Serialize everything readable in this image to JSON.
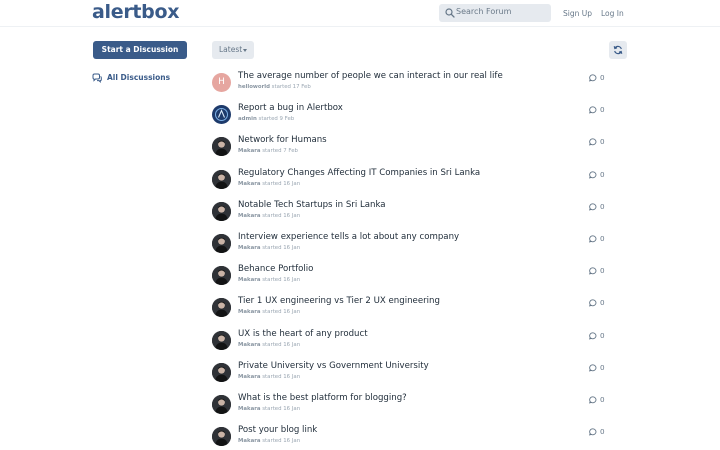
{
  "header": {
    "logo": "alertbox",
    "search_placeholder": "Search Forum",
    "signup_label": "Sign Up",
    "login_label": "Log In"
  },
  "sidebar": {
    "start_label": "Start a Discussion",
    "all_label": "All Discussions"
  },
  "toolbar": {
    "sort_label": "Latest"
  },
  "colors": {
    "brand": "#3a5b89",
    "avatar_letter_bg": "#e6a6a0"
  },
  "discussions": [
    {
      "title": "The average number of people we can interact in our real life",
      "user": "helloworld",
      "started": "started 17 Feb",
      "replies": "0",
      "avatar": "letter",
      "initial": "H"
    },
    {
      "title": "Report a bug in Alertbox",
      "user": "admin",
      "started": "started 9 Feb",
      "replies": "0",
      "avatar": "admin",
      "initial": ""
    },
    {
      "title": "Network for Humans",
      "user": "Makara",
      "started": "started 7 Feb",
      "replies": "0",
      "avatar": "photo",
      "initial": ""
    },
    {
      "title": "Regulatory Changes Affecting IT Companies in Sri Lanka",
      "user": "Makara",
      "started": "started 16 Jan",
      "replies": "0",
      "avatar": "photo",
      "initial": ""
    },
    {
      "title": "Notable Tech Startups in Sri Lanka",
      "user": "Makara",
      "started": "started 16 Jan",
      "replies": "0",
      "avatar": "photo",
      "initial": ""
    },
    {
      "title": "Interview experience tells a lot about any company",
      "user": "Makara",
      "started": "started 16 Jan",
      "replies": "0",
      "avatar": "photo",
      "initial": ""
    },
    {
      "title": "Behance Portfolio",
      "user": "Makara",
      "started": "started 16 Jan",
      "replies": "0",
      "avatar": "photo",
      "initial": ""
    },
    {
      "title": "Tier 1 UX engineering vs Tier 2 UX engineering",
      "user": "Makara",
      "started": "started 16 Jan",
      "replies": "0",
      "avatar": "photo",
      "initial": ""
    },
    {
      "title": "UX is the heart of any product",
      "user": "Makara",
      "started": "started 16 Jan",
      "replies": "0",
      "avatar": "photo",
      "initial": ""
    },
    {
      "title": "Private University vs Government University",
      "user": "Makara",
      "started": "started 16 Jan",
      "replies": "0",
      "avatar": "photo",
      "initial": ""
    },
    {
      "title": "What is the best platform for blogging?",
      "user": "Makara",
      "started": "started 16 Jan",
      "replies": "0",
      "avatar": "photo",
      "initial": ""
    },
    {
      "title": "Post your blog link",
      "user": "Makara",
      "started": "started 16 Jan",
      "replies": "0",
      "avatar": "photo",
      "initial": ""
    }
  ]
}
